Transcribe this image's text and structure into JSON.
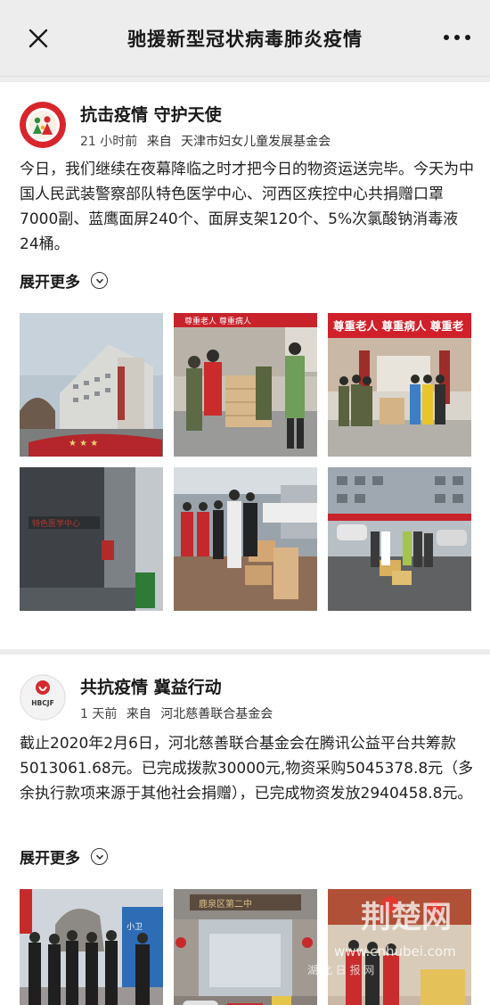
{
  "nav": {
    "title": "驰援新型冠状病毒肺炎疫情",
    "close_icon": "close-icon",
    "more_icon": "more-dots-icon"
  },
  "posts": [
    {
      "title": "抗击疫情 守护天使",
      "time": "21 小时前",
      "source_prefix": "来自",
      "source": "天津市妇女儿童发展基金会",
      "body": "今日，我们继续在夜幕降临之时才把今日的物资运送完毕。今天为中国人民武装警察部队特色医学中心、河西区疾控中心共捐赠口罩7000副、蓝鹰面屏240个、面屏支架120个、5%次氯酸钠消毒液24桶。",
      "expand_label": "展开更多",
      "photo_banners": [
        "尊重老人 尊重病人 尊重老",
        "尊重老人 尊重病人 尊重老"
      ]
    },
    {
      "title": "共抗疫情 冀益行动",
      "time": "1 天前",
      "source_prefix": "来自",
      "source": "河北慈善联合基金会",
      "avatar_text": "HBCJF",
      "body": "截止2020年2月6日，河北慈善联合基金会在腾讯公益平台共筹款5013061.68元。已完成拨款30000元,物资采购5045378.8元（多余执行款项来源于其他社会捐赠），已完成物资发放2940458.8元。",
      "expand_label": "展开更多"
    }
  ],
  "watermark": {
    "site": "www.cnhubei.com",
    "brand": "荆楚网",
    "sub": "湖 北 日 报 网"
  },
  "colors": {
    "background": "#ededed",
    "card": "#ffffff",
    "text": "#191919",
    "banner_red": "#d0202a"
  }
}
